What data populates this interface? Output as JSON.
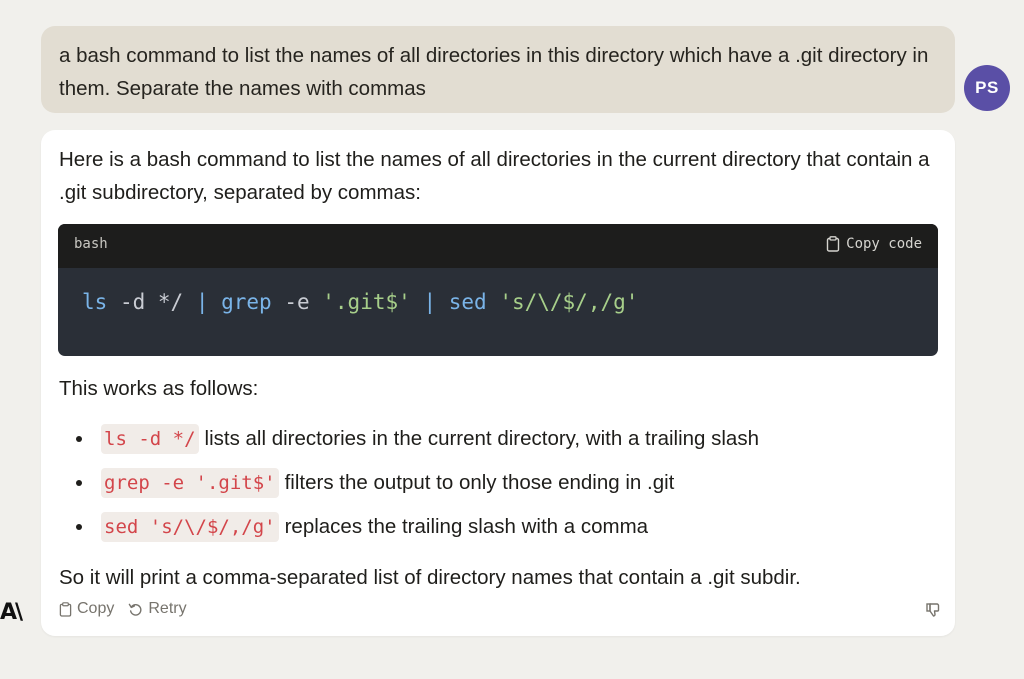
{
  "user_message": {
    "text": "a bash command to list the names of all directories in this directory which have a .git directory in them. Separate the names with commas",
    "avatar_initials": "PS"
  },
  "assistant_message": {
    "intro": "Here is a bash command to list the names of all directories in the current directory that contain a .git subdirectory, separated by commas:",
    "code_block": {
      "language": "bash",
      "copy_label": "Copy code",
      "tokens": {
        "t1": "ls",
        "t2": " -d */ ",
        "t3": "|",
        "t4": " grep",
        "t5": " -e ",
        "t6": "'.git$'",
        "t7": " ",
        "t8": "|",
        "t9": " sed",
        "t10": " ",
        "t11": "'s/\\/$/,/g'"
      }
    },
    "follows_text": "This works as follows:",
    "bullets": [
      {
        "code": "ls -d */",
        "text": "lists all directories in the current directory, with a trailing slash"
      },
      {
        "code": "grep -e '.git$'",
        "text": "filters the output to only those ending in .git"
      },
      {
        "code": "sed 's/\\/$/,/g'",
        "text": "replaces the trailing slash with a comma"
      }
    ],
    "summary": "So it will print a comma-separated list of directory names that contain a .git subdir.",
    "actions": {
      "copy_label": "Copy",
      "retry_label": "Retry"
    }
  },
  "logo_text": "A\\",
  "colors": {
    "background": "#f1f0ec",
    "user_bubble": "#e2ddd2",
    "avatar": "#5a4fa6",
    "code_bg": "#2a2f37",
    "code_header": "#1d1d1c",
    "inline_code": "#d3454a"
  },
  "icons": {
    "copy_code": "clipboard-icon",
    "copy": "clipboard-icon",
    "retry": "retry-icon",
    "feedback": "thumbs-down-icon"
  }
}
